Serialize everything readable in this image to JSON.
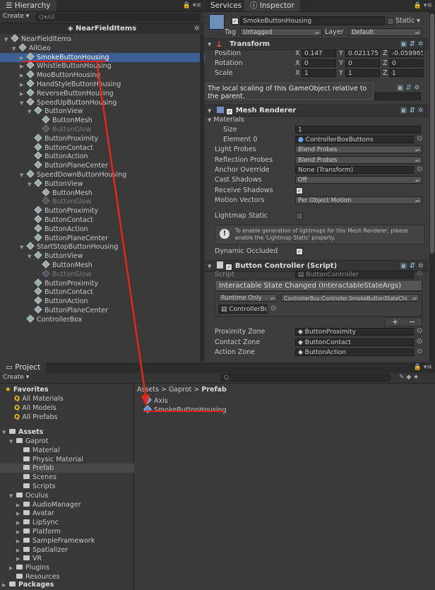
{
  "hierarchy": {
    "tab": "Hierarchy",
    "create": "Create ▾",
    "search_placeholder": "Q▾All",
    "scene_title": "NearFieldItems",
    "items": [
      {
        "label": "NearFieldItems",
        "depth": 0,
        "arrow": "▼",
        "dim": false
      },
      {
        "label": "AllGeo",
        "depth": 1,
        "arrow": "▼",
        "dim": false
      },
      {
        "label": "SmokeButtonHousing",
        "depth": 2,
        "arrow": "▶",
        "dim": false,
        "selected": true
      },
      {
        "label": "WhistleButtonHousing",
        "depth": 2,
        "arrow": "▶",
        "dim": false
      },
      {
        "label": "MooButtonHousing",
        "depth": 2,
        "arrow": "▶",
        "dim": false
      },
      {
        "label": "HandStyleButtonHousing",
        "depth": 2,
        "arrow": "▶",
        "dim": false
      },
      {
        "label": "ReverseButtonHousing",
        "depth": 2,
        "arrow": "▶",
        "dim": false
      },
      {
        "label": "SpeedUpButtonHousing",
        "depth": 2,
        "arrow": "▼",
        "dim": false
      },
      {
        "label": "ButtonView",
        "depth": 3,
        "arrow": "▼",
        "dim": false
      },
      {
        "label": "ButtonMesh",
        "depth": 4,
        "arrow": "",
        "dim": false
      },
      {
        "label": "ButtonGlow",
        "depth": 4,
        "arrow": "",
        "dim": true
      },
      {
        "label": "ButtonProximity",
        "depth": 3,
        "arrow": "",
        "dim": false
      },
      {
        "label": "ButtonContact",
        "depth": 3,
        "arrow": "",
        "dim": false
      },
      {
        "label": "ButtonAction",
        "depth": 3,
        "arrow": "",
        "dim": false
      },
      {
        "label": "ButtonPlaneCenter",
        "depth": 3,
        "arrow": "",
        "dim": false
      },
      {
        "label": "SpeedDownButtonHousing",
        "depth": 2,
        "arrow": "▼",
        "dim": false
      },
      {
        "label": "ButtonView",
        "depth": 3,
        "arrow": "▼",
        "dim": false
      },
      {
        "label": "ButtonMesh",
        "depth": 4,
        "arrow": "",
        "dim": false
      },
      {
        "label": "ButtonGlow",
        "depth": 4,
        "arrow": "",
        "dim": true
      },
      {
        "label": "ButtonProximity",
        "depth": 3,
        "arrow": "",
        "dim": false
      },
      {
        "label": "ButtonContact",
        "depth": 3,
        "arrow": "",
        "dim": false
      },
      {
        "label": "ButtonAction",
        "depth": 3,
        "arrow": "",
        "dim": false
      },
      {
        "label": "ButtonPlaneCenter",
        "depth": 3,
        "arrow": "",
        "dim": false
      },
      {
        "label": "StartStopButtonHousing",
        "depth": 2,
        "arrow": "▼",
        "dim": false
      },
      {
        "label": "ButtonView",
        "depth": 3,
        "arrow": "▼",
        "dim": false
      },
      {
        "label": "ButtonMesh",
        "depth": 4,
        "arrow": "",
        "dim": false
      },
      {
        "label": "ButtonGlow",
        "depth": 4,
        "arrow": "",
        "dim": true
      },
      {
        "label": "ButtonProximity",
        "depth": 3,
        "arrow": "",
        "dim": false
      },
      {
        "label": "ButtonContact",
        "depth": 3,
        "arrow": "",
        "dim": false
      },
      {
        "label": "ButtonAction",
        "depth": 3,
        "arrow": "",
        "dim": false
      },
      {
        "label": "ButtonPlaneCenter",
        "depth": 3,
        "arrow": "",
        "dim": false
      },
      {
        "label": "ControllerBox",
        "depth": 2,
        "arrow": "",
        "dim": false
      }
    ]
  },
  "inspector": {
    "tabs": [
      "Services",
      "Inspector"
    ],
    "object_name": "SmokeButtonHousing",
    "static_label": "Static ▾",
    "tag_label": "Tag",
    "tag_value": "Untagged",
    "layer_label": "Layer",
    "layer_value": "Default",
    "transform": {
      "title": "Transform",
      "position_label": "Position",
      "rotation_label": "Rotation",
      "scale_label": "Scale",
      "position": [
        "0.147",
        "0.021175:",
        "-0.059965"
      ],
      "rotation": [
        "0",
        "0",
        "0"
      ],
      "scale": [
        "1",
        "1",
        "1"
      ],
      "axis": [
        "X",
        "Y",
        "Z"
      ]
    },
    "tooltip": "The local scaling of this GameObject relative to the parent.",
    "mesh_renderer": {
      "title": "Mesh Renderer",
      "materials_label": "Materials",
      "size_label": "Size",
      "size_value": "1",
      "element0_label": "Element 0",
      "element0_value": "ControllerBoxButtons",
      "light_probes_label": "Light Probes",
      "light_probes_value": "Blend Probes",
      "reflection_probes_label": "Reflection Probes",
      "reflection_probes_value": "Blend Probes",
      "anchor_override_label": "Anchor Override",
      "anchor_override_value": "None (Transform)",
      "cast_shadows_label": "Cast Shadows",
      "cast_shadows_value": "Off",
      "receive_shadows_label": "Receive Shadows",
      "motion_vectors_label": "Motion Vectors",
      "motion_vectors_value": "Per Object Motion",
      "lightmap_static_label": "Lightmap Static",
      "info_text": "To enable generation of lightmaps for this Mesh Renderer, please enable the 'Lightmap Static' property.",
      "dynamic_occluded_label": "Dynamic Occluded"
    },
    "button_controller": {
      "title": "Button Controller (Script)",
      "script_label": "Script",
      "script_value": "ButtonController",
      "event_title": "Interactable State Changed (InteractableStateArgs)",
      "runtime_value": "Runtime Only",
      "function_value": "ControllerBox:Controller.SmokeButtonStateChi",
      "object_value": "ControllerBo",
      "plus": "+",
      "minus": "−",
      "proximity_label": "Proximity Zone",
      "proximity_value": "ButtonProximity",
      "contact_label": "Contact Zone",
      "contact_value": "ButtonContact",
      "action_label": "Action Zone",
      "action_value": "ButtonAction"
    }
  },
  "project": {
    "tab": "Project",
    "create": "Create ▾",
    "favorites_label": "Favorites",
    "favorites": [
      "All Materials",
      "All Models",
      "All Prefabs"
    ],
    "assets_label": "Assets",
    "tree": [
      {
        "label": "Gaprot",
        "depth": 1,
        "arrow": "▼"
      },
      {
        "label": "Material",
        "depth": 2,
        "arrow": ""
      },
      {
        "label": "Physic Material",
        "depth": 2,
        "arrow": ""
      },
      {
        "label": "Prefab",
        "depth": 2,
        "arrow": "",
        "selected": true
      },
      {
        "label": "Scenes",
        "depth": 2,
        "arrow": ""
      },
      {
        "label": "Scripts",
        "depth": 2,
        "arrow": ""
      },
      {
        "label": "Oculus",
        "depth": 1,
        "arrow": "▼"
      },
      {
        "label": "AudioManager",
        "depth": 2,
        "arrow": "▶"
      },
      {
        "label": "Avatar",
        "depth": 2,
        "arrow": "▶"
      },
      {
        "label": "LipSync",
        "depth": 2,
        "arrow": "▶"
      },
      {
        "label": "Platform",
        "depth": 2,
        "arrow": "▶"
      },
      {
        "label": "SampleFramework",
        "depth": 2,
        "arrow": "▶"
      },
      {
        "label": "Spatializer",
        "depth": 2,
        "arrow": "▶"
      },
      {
        "label": "VR",
        "depth": 2,
        "arrow": "▶"
      },
      {
        "label": "Plugins",
        "depth": 1,
        "arrow": "▶"
      },
      {
        "label": "Resources",
        "depth": 1,
        "arrow": ""
      }
    ],
    "packages_label": "Packages",
    "breadcrumb": [
      "Assets",
      "Gaprot",
      "Prefab"
    ],
    "files": [
      "Axis",
      "SmokeButtonHousing"
    ]
  },
  "colors": {
    "accent": "#3e5f96",
    "annotation": "#e8261b"
  }
}
